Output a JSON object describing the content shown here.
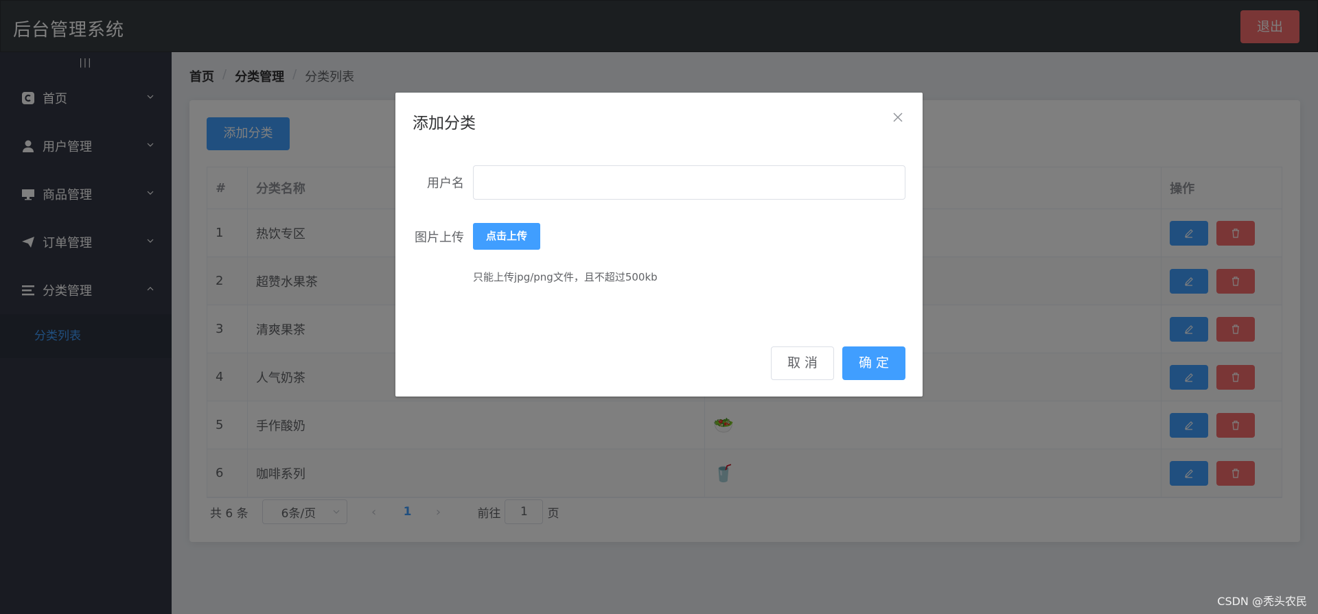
{
  "header": {
    "title": "后台管理系统",
    "logout_label": "退出"
  },
  "sidebar": {
    "collapse_label": "|||",
    "items": [
      {
        "label": "首页",
        "icon": "home-icon"
      },
      {
        "label": "用户管理",
        "icon": "user-icon"
      },
      {
        "label": "商品管理",
        "icon": "monitor-icon"
      },
      {
        "label": "订单管理",
        "icon": "send-icon"
      },
      {
        "label": "分类管理",
        "icon": "menu-icon"
      }
    ],
    "sub_item": "分类列表"
  },
  "breadcrumb": {
    "home": "首页",
    "section": "分类管理",
    "page": "分类列表",
    "sep": "/"
  },
  "main": {
    "add_button": "添加分类",
    "table": {
      "headers": [
        "#",
        "分类名称",
        "",
        "操作"
      ],
      "rows": [
        {
          "id": "1",
          "name": "热饮专区"
        },
        {
          "id": "2",
          "name": "超赞水果茶"
        },
        {
          "id": "3",
          "name": "清爽果茶"
        },
        {
          "id": "4",
          "name": "人气奶茶"
        },
        {
          "id": "5",
          "name": "手作酸奶",
          "image": "🥗"
        },
        {
          "id": "6",
          "name": "咖啡系列",
          "image": "🥤"
        }
      ]
    },
    "pagination": {
      "total": "共 6 条",
      "page_size": "6条/页",
      "current": "1",
      "goto_label": "前往",
      "goto_value": "1",
      "page_word": "页"
    }
  },
  "dialog": {
    "title": "添加分类",
    "username_label": "用户名",
    "username_value": "",
    "upload_label": "图片上传",
    "upload_button": "点击上传",
    "upload_tip": "只能上传jpg/png文件，且不超过500kb",
    "cancel_label": "取 消",
    "confirm_label": "确 定"
  },
  "watermark": "CSDN @秃头农民",
  "colors": {
    "primary": "#409eff",
    "danger": "#f56c6c",
    "header_bg": "#373d41",
    "sidebar_bg": "#333744"
  }
}
